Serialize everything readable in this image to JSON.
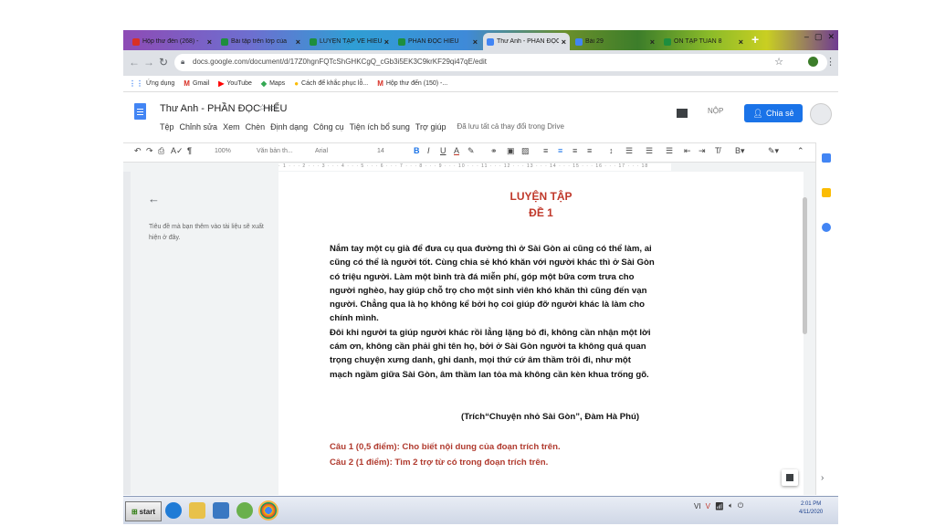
{
  "tabs": [
    {
      "label": "Hộp thư đến (268) -",
      "color": "#d93025"
    },
    {
      "label": "Bài tập trên lớp của",
      "color": "#1e8e3e"
    },
    {
      "label": "LUYỆN TẬP VỀ HIỂU",
      "color": "#1e8e3e"
    },
    {
      "label": "PHẦN ĐỌC HIỂU",
      "color": "#1e8e3e"
    },
    {
      "label": "Thư Anh - PHẦN ĐỌC",
      "color": "#4285f4"
    },
    {
      "label": "Bài 29",
      "color": "#4285f4"
    },
    {
      "label": "ÔN TẬP TUẦN 8",
      "color": "#1e8e3e"
    }
  ],
  "address": {
    "url": "docs.google.com/document/d/17Z0hgnFQTcShGHKCgQ_cGb3i5EK3C9krKF29qi47qE/edit"
  },
  "bookmarks": [
    {
      "label": "Ứng dụng",
      "icon": "apps-icon"
    },
    {
      "label": "Gmail",
      "icon": "gmail-icon"
    },
    {
      "label": "YouTube",
      "icon": "youtube-icon"
    },
    {
      "label": "Maps",
      "icon": "maps-icon"
    },
    {
      "label": "Cách để khắc phục lỗ...",
      "icon": "bookmark-icon"
    },
    {
      "label": "Hộp thư đến (150) -...",
      "icon": "gmail-icon"
    }
  ],
  "doc": {
    "title": "Thư Anh - PHẦN ĐỌC HIỂU",
    "menus": [
      "Tệp",
      "Chỉnh sửa",
      "Xem",
      "Chèn",
      "Định dạng",
      "Công cụ",
      "Tiện ích bổ sung",
      "Trợ giúp"
    ],
    "saved": "Đã lưu tất cả thay đổi trong Drive",
    "submit": "NỘP",
    "share": "Chia sẻ"
  },
  "toolbar": {
    "zoom": "100%",
    "style": "Văn bản th...",
    "font": "Arial",
    "size": "14"
  },
  "outline": {
    "hint": "Tiêu đề mà bạn thêm vào tài liệu sẽ xuất hiện ở đây."
  },
  "content": {
    "heading1": "LUYỆN TẬP",
    "heading2": "ĐỀ 1",
    "para1": "Nắm tay một cụ già để đưa cụ qua đường thì ở Sài Gòn ai cũng có thể làm, ai cũng có thể là người tốt. Cùng chia sẻ khó khăn với người khác thì ở Sài Gòn có triệu người. Làm một bình trà đá miễn phí, góp một bữa cơm trưa cho người nghèo, hay giúp chỗ trọ cho một sinh viên khó khăn thì cũng đến vạn người. Chẳng qua là họ không kể bởi họ coi giúp đỡ người khác là làm cho chính mình.",
    "para2": "Đôi khi người ta giúp người khác rồi lẳng lặng bỏ đi, không cần nhận một lời cám ơn, không cần phải ghi tên họ, bởi ở Sài Gòn người ta không quá quan trọng chuyện xưng danh, ghi danh, mọi thứ cứ âm thầm trôi đi, như một mạch ngầm giữa Sài Gòn, âm thầm lan tỏa mà không cần kèn khua trống gõ.",
    "citation": "(Trích“Chuyện nhỏ Sài Gòn”, Đàm Hà Phú)",
    "q1": "Câu 1 (0,5 điểm): Cho biết nội dung của đoạn trích trên.",
    "q2": "Câu 2 (1 điểm): Tìm 2 trợ từ có trong đoạn trích trên."
  },
  "taskbar": {
    "start": "start",
    "time": "2:01 PM",
    "date": "4/11/2020",
    "lang": "VI"
  }
}
